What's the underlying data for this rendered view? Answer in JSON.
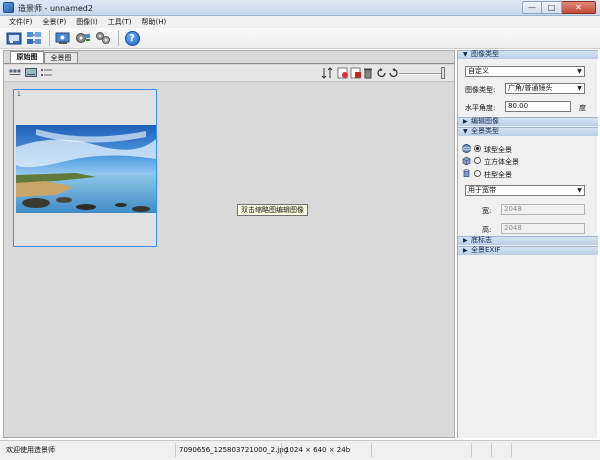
{
  "window": {
    "title": "造景师 - unnamed2",
    "min_glyph": "—",
    "max_glyph": "□",
    "close_glyph": "✕"
  },
  "menu": [
    "文件(F)",
    "全景(P)",
    "图像(I)",
    "工具(T)",
    "帮助(H)"
  ],
  "toolbar": {
    "buttons": [
      "open-icon",
      "stitch-icon",
      "export-icon",
      "settings-icon",
      "tools-icon"
    ],
    "help_glyph": "?"
  },
  "tabs": {
    "original": "原始图",
    "panorama": "全景图"
  },
  "thumbnail": {
    "index": "1",
    "filename": "7090656_125803721000_2.jpg"
  },
  "tooltip": "双击缩略图编辑图像",
  "right": {
    "image_type_header": "图像类型",
    "image_type_value": "自定义",
    "lens_label": "图像类型:",
    "lens_value": "广角/普通镜头",
    "hfov_label": "水平角度:",
    "hfov_value": "80.00",
    "hfov_unit": "度",
    "edit_image_header": "编辑图像",
    "panorama_type_header": "全景类型",
    "proj_sphere": "球型全景",
    "proj_cube": "立方体全景",
    "proj_cylinder": "柱型全景",
    "size_preset": "用于宽带",
    "width_label": "宽:",
    "width_value": "2048",
    "height_label": "高:",
    "height_value": "2048",
    "nadir_header": "底标志",
    "exif_header": "全景EXIF"
  },
  "status": {
    "message": "欢迎使用造景师",
    "file": "7090656_125803721000_2.jpg",
    "dimensions": "1024 × 640 × 24b"
  },
  "colors": {
    "selection": "#3d8ee8",
    "section_header": "#b8cfe8",
    "tooltip_bg": "#ffffe1"
  }
}
